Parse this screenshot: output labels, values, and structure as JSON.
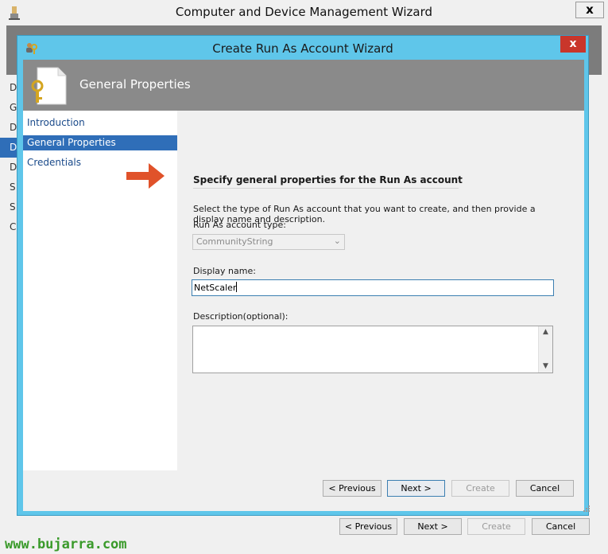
{
  "outer": {
    "title": "Computer and Device Management Wizard",
    "close_glyph": "x",
    "left_letters": [
      "D",
      "G",
      "D",
      "D",
      "D",
      "S",
      "S",
      "C"
    ],
    "selected_index": 3,
    "buttons": {
      "previous": "< Previous",
      "next": "Next >",
      "create": "Create",
      "cancel": "Cancel"
    }
  },
  "inner": {
    "title": "Create Run As Account Wizard",
    "close_glyph": "x",
    "header_title": "General Properties",
    "nav": [
      "Introduction",
      "General Properties",
      "Credentials"
    ],
    "nav_selected": "General Properties",
    "section_title": "Specify general properties for the Run As account",
    "instructions": "Select the type of Run As account that you want to create, and then provide a display name and description.",
    "account_type_label": "Run As account type:",
    "account_type_value": "CommunityString",
    "display_name_label": "Display name:",
    "display_name_value": "NetScaler",
    "description_label": "Description(optional):",
    "description_value": "",
    "buttons": {
      "previous": "< Previous",
      "next": "Next >",
      "create": "Create",
      "cancel": "Cancel"
    }
  },
  "watermark": "www.bujarra.com",
  "colors": {
    "title_accent": "#5fc6ea",
    "header_gray": "#8a8a8a",
    "selection_blue": "#2f6eb8",
    "close_red": "#c9362b",
    "annotation_arrow": "#e0522a",
    "watermark_green": "#3a9a2a"
  },
  "icons": {
    "outer_app": "wizard-app-icon",
    "inner_app": "users-key-icon",
    "header": "document-key-icon",
    "annotation": "arrow-right-icon"
  }
}
